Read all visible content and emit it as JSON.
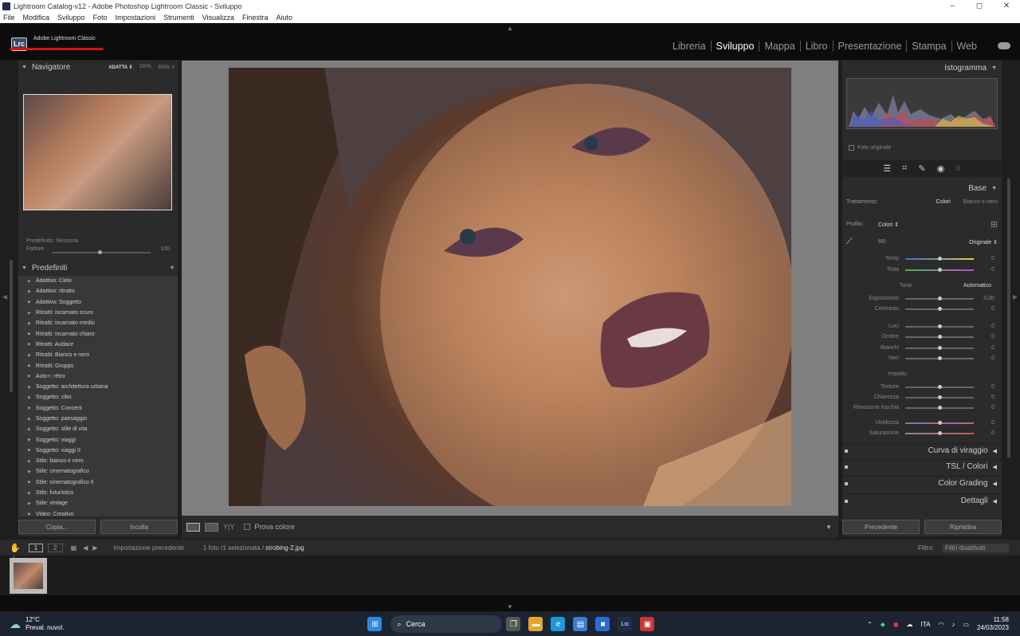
{
  "window": {
    "title": "Lightroom Catalog-v12 - Adobe Photoshop Lightroom Classic - Sviluppo",
    "min": "–",
    "max": "◻",
    "close": "✕"
  },
  "menu": [
    "File",
    "Modifica",
    "Sviluppo",
    "Foto",
    "Impostazioni",
    "Strumenti",
    "Visualizza",
    "Finestra",
    "Aiuto"
  ],
  "brand": {
    "logo": "Lrc",
    "name": "Adobe Lightroom Classic"
  },
  "modules": [
    "Libreria",
    "Sviluppo",
    "Mappa",
    "Libro",
    "Presentazione",
    "Stampa",
    "Web"
  ],
  "active_module": "Sviluppo",
  "navigator": {
    "title": "Navigatore",
    "opt1": "ADATTA ⇕",
    "opt2": "100%",
    "opt3": "300% ⇕"
  },
  "preset_info": {
    "line1": "Predefinito: Nessuna",
    "amount_label": "Fattore",
    "amount_value": "100"
  },
  "presets": {
    "title": "Predefiniti",
    "plus": "+",
    "items": [
      "Adattivo: Cielo",
      "Adattivo: ritratto",
      "Adattivo: Soggetto",
      "Ritratti: incarnato scuro",
      "Ritratti: incarnato medio",
      "Ritratti: incarnato chiaro",
      "Ritratti: Audace",
      "Ritratti: Bianco e nero",
      "Ritratti: Gruppo",
      "Auto+: rétro",
      "Soggetto: architettura urbana",
      "Soggetto: cibo",
      "Soggetto: Concerti",
      "Soggetto: paesaggio",
      "Soggetto: stile di vita",
      "Soggetto: viaggi",
      "Soggetto: viaggi II",
      "Stile: bianco e nero",
      "Stile: cinematografico",
      "Stile: cinematografico II",
      "Stile: futuristico",
      "Stile: vintage",
      "Video: Creativo"
    ]
  },
  "left_buttons": {
    "copy": "Copia...",
    "paste": "Incolla"
  },
  "toolbar": {
    "soft_proof": "Prova colore",
    "yy": "Y|Y"
  },
  "right": {
    "histogram_title": "Istogramma",
    "foto_originale": "Foto originale",
    "base_title": "Base",
    "trattamento_label": "Trattamento:",
    "trattamento_colori": "Colori",
    "trattamento_bn": "Bianco e nero",
    "profilo_label": "Profilo:",
    "profilo_value": "Colori ⇕",
    "bb_label": "BB:",
    "bb_value": "Originale ⇕",
    "tono_label": "Tono",
    "auto_label": "Automatico",
    "impatto_label": "Impatto",
    "sliders": [
      {
        "label": "Temp",
        "value": "0"
      },
      {
        "label": "Tinta",
        "value": "0"
      },
      {
        "label": "Esposizione",
        "value": "0,00"
      },
      {
        "label": "Contrasto",
        "value": "0"
      },
      {
        "label": "Luci",
        "value": "0"
      },
      {
        "label": "Ombre",
        "value": "0"
      },
      {
        "label": "Bianchi",
        "value": "0"
      },
      {
        "label": "Neri",
        "value": "0"
      },
      {
        "label": "Texture",
        "value": "0"
      },
      {
        "label": "Chiarezza",
        "value": "0"
      },
      {
        "label": "Rimozione foschia",
        "value": "0"
      },
      {
        "label": "Vividezza",
        "value": "0"
      },
      {
        "label": "Saturazione",
        "value": "0"
      }
    ],
    "sections": [
      "Curva di viraggio",
      "TSL / Colori",
      "Color Grading",
      "Dettagli"
    ],
    "prev_button": "Precedente",
    "reset_button": "Ripristina"
  },
  "filmbar": {
    "screen1": "1",
    "screen2": "2",
    "source": "Importazione precedente",
    "count": "1 foto /1 selezionata /",
    "filename": "strobing-2.jpg",
    "filter_label": "Filtro:",
    "filter_value": "Filtri disattivati"
  },
  "filmstrip": {
    "index": "1"
  },
  "taskbar": {
    "temp": "12°C",
    "weather": "Preval. nuvol.",
    "search": "Cerca",
    "lang": "ITA",
    "time": "11:58",
    "date": "24/03/2023"
  }
}
